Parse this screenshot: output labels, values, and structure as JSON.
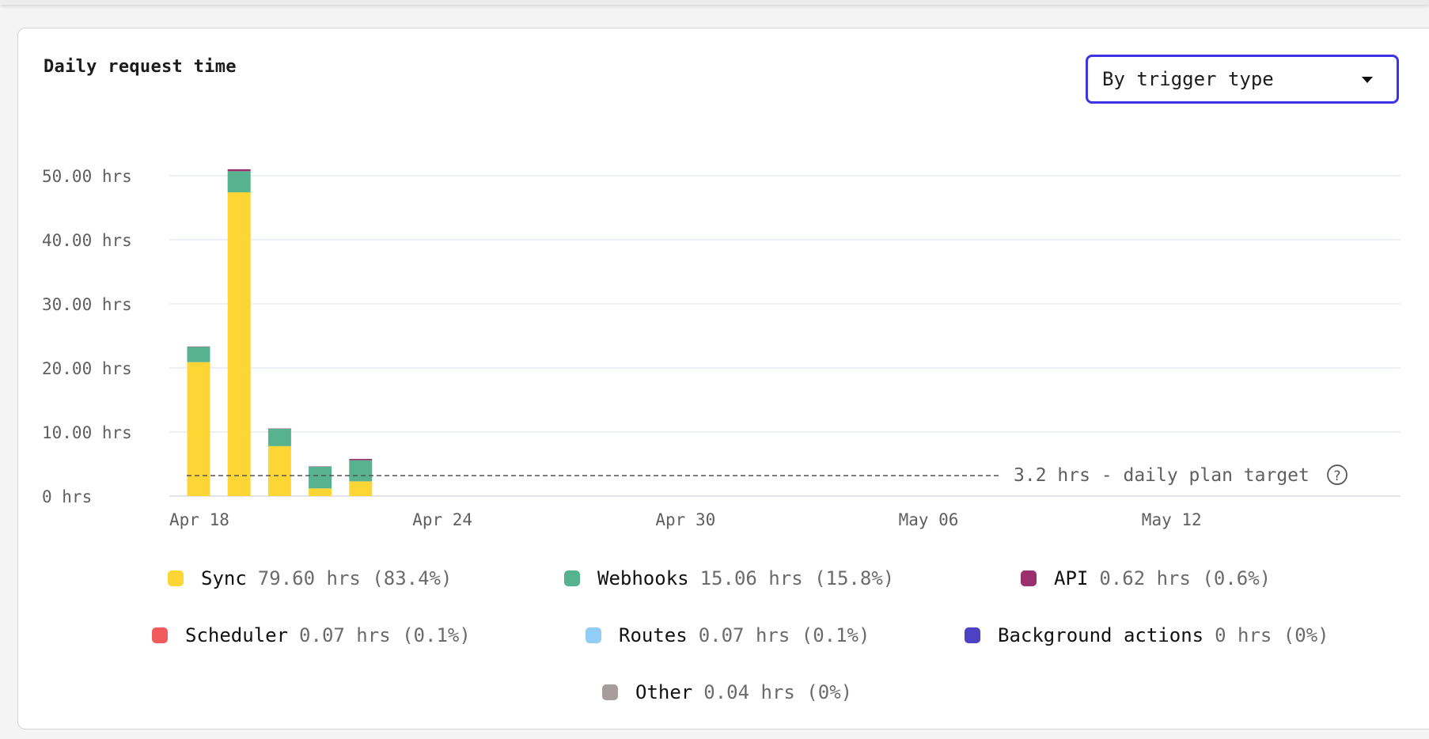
{
  "title": "Daily request time",
  "dropdown": {
    "selected": "By trigger type"
  },
  "chart_data": {
    "type": "bar",
    "stacked": true,
    "categories": [
      "Apr 18",
      "Apr 19",
      "Apr 20",
      "Apr 21",
      "Apr 22"
    ],
    "x_ticks": [
      "Apr 18",
      "Apr 24",
      "Apr 30",
      "May 06",
      "May 12"
    ],
    "y_ticks": [
      "0 hrs",
      "10.00 hrs",
      "20.00 hrs",
      "30.00 hrs",
      "40.00 hrs",
      "50.00 hrs"
    ],
    "ylim": [
      0,
      50
    ],
    "series": [
      {
        "name": "Sync",
        "color": "#fdd535",
        "values": [
          20.9,
          47.4,
          7.8,
          1.2,
          2.3
        ]
      },
      {
        "name": "Webhooks",
        "color": "#57b38f",
        "values": [
          2.4,
          3.3,
          2.7,
          3.4,
          3.3
        ]
      },
      {
        "name": "API",
        "color": "#9c2f6e",
        "values": [
          0.05,
          0.3,
          0.05,
          0.05,
          0.2
        ]
      }
    ],
    "target": {
      "value": 3.2,
      "label": "3.2 hrs - daily plan target"
    },
    "grid": true
  },
  "legend": [
    {
      "name": "Sync",
      "value": "79.60 hrs (83.4%)",
      "color": "#fdd535"
    },
    {
      "name": "Webhooks",
      "value": "15.06 hrs (15.8%)",
      "color": "#57b38f"
    },
    {
      "name": "API",
      "value": "0.62 hrs (0.6%)",
      "color": "#9c2f6e"
    },
    {
      "name": "Scheduler",
      "value": "0.07 hrs (0.1%)",
      "color": "#f25b5b"
    },
    {
      "name": "Routes",
      "value": "0.07 hrs (0.1%)",
      "color": "#93cdf5"
    },
    {
      "name": "Background actions",
      "value": "0 hrs (0%)",
      "color": "#4d42c4"
    },
    {
      "name": "Other",
      "value": "0.04 hrs (0%)",
      "color": "#a69c9c"
    }
  ],
  "icons": {
    "help": "help-circle-icon",
    "dropdown": "chevron-down-icon"
  }
}
